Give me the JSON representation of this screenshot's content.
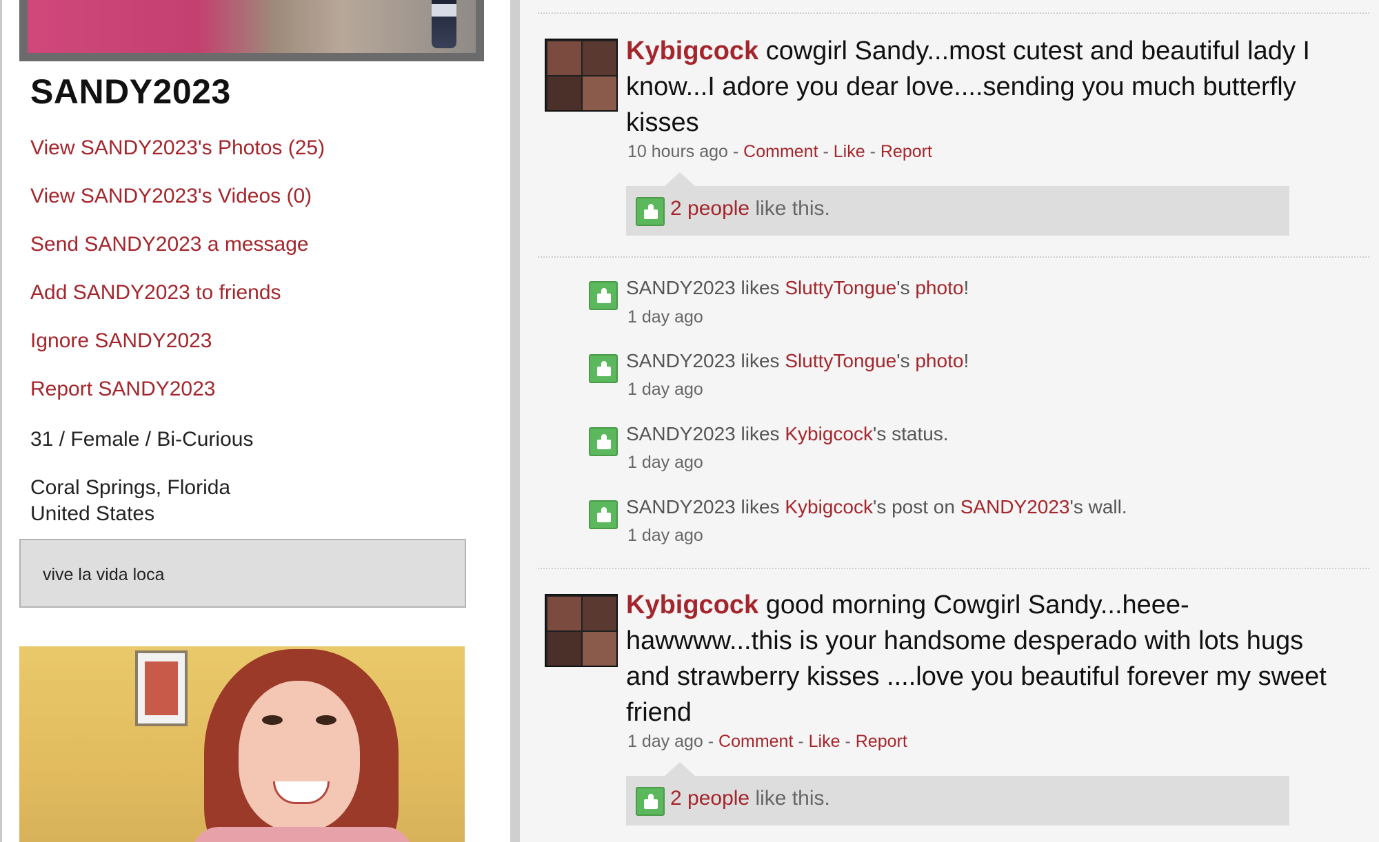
{
  "profile": {
    "name": "SANDY2023",
    "links": [
      {
        "label": "View SANDY2023's Photos (25)"
      },
      {
        "label": "View SANDY2023's Videos (0)"
      },
      {
        "label": "Send SANDY2023 a message"
      },
      {
        "label": "Add SANDY2023 to friends"
      },
      {
        "label": "Ignore SANDY2023"
      },
      {
        "label": "Report SANDY2023"
      }
    ],
    "demographics": "31 / Female / Bi-Curious",
    "location_city": "Coral Springs, Florida",
    "location_country": "United States",
    "motto": "vive la vida loca"
  },
  "feed": {
    "posts": [
      {
        "author": "Kybigcock",
        "text": " cowgirl Sandy...most cutest and beautiful lady I know...I adore you dear love....sending you much butterfly kisses",
        "time": "10 hours ago",
        "actions": [
          "Comment",
          "Like",
          "Report"
        ],
        "likes_link": "2 people",
        "likes_suffix": " like this."
      },
      {
        "author": "Kybigcock",
        "text": " good morning Cowgirl Sandy...heee-hawwww...this is your handsome desperado with lots hugs and strawberry kisses ....love you beautiful forever my sweet friend",
        "time": "1 day ago",
        "actions": [
          "Comment",
          "Like",
          "Report"
        ],
        "likes_link": "2 people",
        "likes_suffix": " like this."
      }
    ],
    "activities": [
      {
        "user": "SANDY2023",
        "verb": " likes ",
        "target": "SluttyTongue",
        "possessive": "'s ",
        "object": "photo",
        "tail": "!",
        "time": "1 day ago"
      },
      {
        "user": "SANDY2023",
        "verb": " likes ",
        "target": "SluttyTongue",
        "possessive": "'s ",
        "object": "photo",
        "tail": "!",
        "time": "1 day ago"
      },
      {
        "user": "SANDY2023",
        "verb": " likes ",
        "target": "Kybigcock",
        "possessive": "'s status.",
        "time": "1 day ago"
      },
      {
        "user": "SANDY2023",
        "verb": " likes ",
        "target": "Kybigcock",
        "possessive": "'s post on ",
        "object": "SANDY2023",
        "tail": "'s wall.",
        "time": "1 day ago"
      }
    ],
    "separator": " - "
  },
  "icons": {
    "like": "thumbs-up-icon"
  },
  "colors": {
    "link": "#a4262c",
    "like_icon": "#5cb85c",
    "feed_bg": "#f5f5f5",
    "like_box_bg": "#dddddd"
  }
}
